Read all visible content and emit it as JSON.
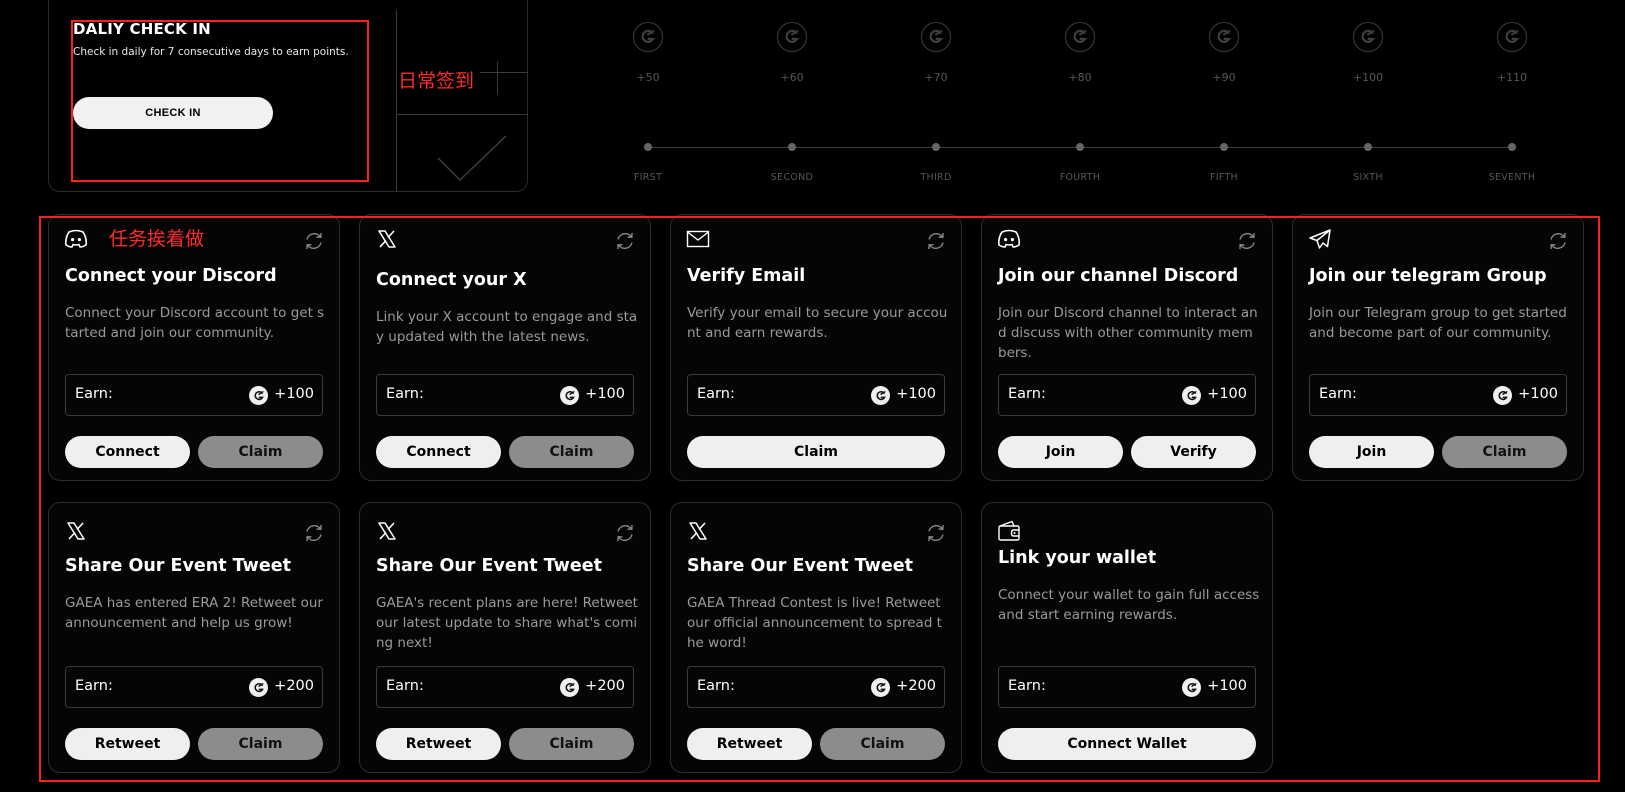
{
  "checkin": {
    "title": "DALIY CHECK IN",
    "description": "Check in daily for 7 consecutive days to earn points.",
    "button_label": "CHECK IN"
  },
  "annotations": {
    "daily_label": "日常签到",
    "tasks_label": "任务挨着做",
    "color": "#ff1f1f"
  },
  "days": [
    {
      "points": "+50",
      "label": "FIRST"
    },
    {
      "points": "+60",
      "label": "SECOND"
    },
    {
      "points": "+70",
      "label": "THIRD"
    },
    {
      "points": "+80",
      "label": "FOURTH"
    },
    {
      "points": "+90",
      "label": "FIFTH"
    },
    {
      "points": "+100",
      "label": "SIXTH"
    },
    {
      "points": "+110",
      "label": "SEVENTH"
    }
  ],
  "tasks": [
    {
      "icon": "discord-icon",
      "title": "Connect your Discord",
      "description": "Connect your Discord account to get started and join our community.",
      "earn_label": "Earn:",
      "earn_value": "+100",
      "buttons": [
        {
          "label": "Connect",
          "style": "light"
        },
        {
          "label": "Claim",
          "style": "dim"
        }
      ]
    },
    {
      "icon": "x-icon",
      "title": "Connect your X",
      "description": "Link your X account to engage and stay updated with the latest news.",
      "earn_label": "Earn:",
      "earn_value": "+100",
      "buttons": [
        {
          "label": "Connect",
          "style": "light"
        },
        {
          "label": "Claim",
          "style": "dim"
        }
      ]
    },
    {
      "icon": "mail-icon",
      "title": "Verify Email",
      "description": "Verify your email to secure your account and earn rewards.",
      "earn_label": "Earn:",
      "earn_value": "+100",
      "buttons": [
        {
          "label": "Claim",
          "style": "light"
        }
      ]
    },
    {
      "icon": "discord-icon",
      "title": "Join our channel Discord",
      "description": "Join our Discord channel to interact and discuss with other community members.",
      "earn_label": "Earn:",
      "earn_value": "+100",
      "buttons": [
        {
          "label": "Join",
          "style": "light"
        },
        {
          "label": "Verify",
          "style": "light"
        }
      ]
    },
    {
      "icon": "telegram-icon",
      "title": "Join our telegram Group",
      "description": "Join our Telegram group to get started and become part of our community.",
      "earn_label": "Earn:",
      "earn_value": "+100",
      "buttons": [
        {
          "label": "Join",
          "style": "light"
        },
        {
          "label": "Claim",
          "style": "dim"
        }
      ]
    },
    {
      "icon": "x-icon",
      "title": "Share Our Event Tweet",
      "description": "GAEA has entered ERA 2! Retweet our announcement and help us grow!",
      "earn_label": "Earn:",
      "earn_value": "+200",
      "buttons": [
        {
          "label": "Retweet",
          "style": "light"
        },
        {
          "label": "Claim",
          "style": "dim"
        }
      ]
    },
    {
      "icon": "x-icon",
      "title": "Share Our Event Tweet",
      "description": "GAEA's recent plans are here! Retweet our latest update to share what's coming next!",
      "earn_label": "Earn:",
      "earn_value": "+200",
      "buttons": [
        {
          "label": "Retweet",
          "style": "light"
        },
        {
          "label": "Claim",
          "style": "dim"
        }
      ]
    },
    {
      "icon": "x-icon",
      "title": "Share Our Event Tweet",
      "description": "GAEA Thread Contest is live! Retweet our official announcement to spread the word!",
      "earn_label": "Earn:",
      "earn_value": "+200",
      "buttons": [
        {
          "label": "Retweet",
          "style": "light"
        },
        {
          "label": "Claim",
          "style": "dim"
        }
      ]
    },
    {
      "icon": "wallet-icon",
      "title": "Link your wallet",
      "description": "Connect your wallet to gain full access and start earning rewards.",
      "earn_label": "Earn:",
      "earn_value": "+100",
      "buttons": [
        {
          "label": "Connect Wallet",
          "style": "light"
        }
      ]
    }
  ]
}
